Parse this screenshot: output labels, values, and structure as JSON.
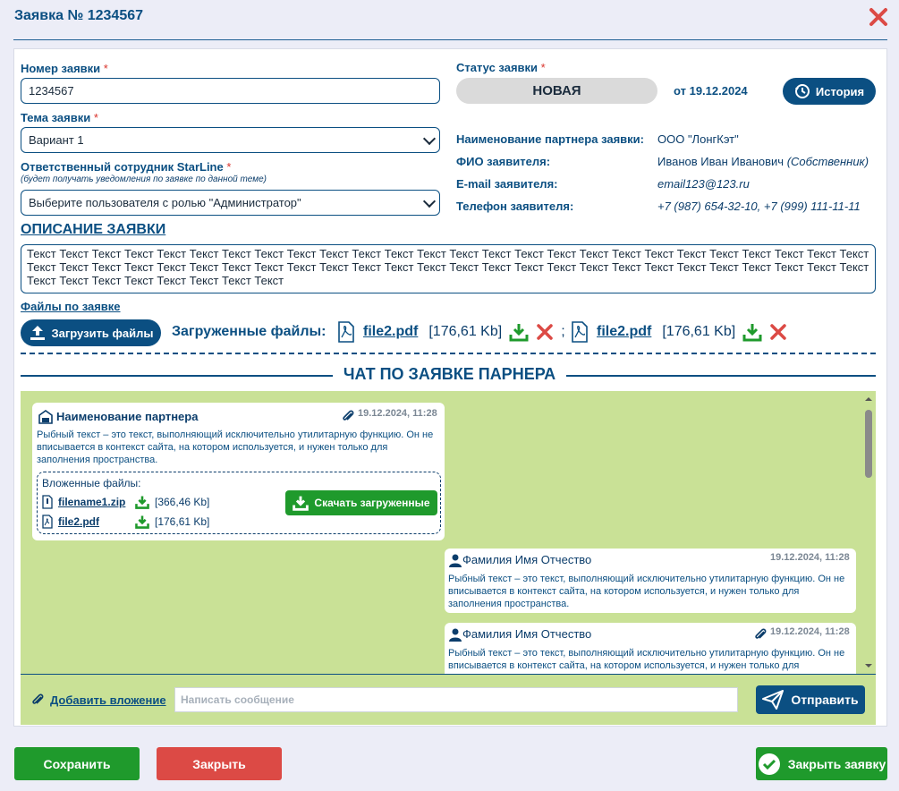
{
  "window": {
    "title": "Заявка № 1234567"
  },
  "form": {
    "number_label": "Номер заявки",
    "number_value": "1234567",
    "topic_label": "Тема заявки",
    "topic_value": "Вариант 1",
    "responsible_label": "Ответственный сотрудник StarLine",
    "responsible_hint": "(будет получать уведомления по заявке по данной теме)",
    "responsible_value": "Выберите пользователя с ролью \"Администратор\"",
    "required_mark": "*"
  },
  "status": {
    "label": "Статус заявки",
    "value": "НОВАЯ",
    "date": "от 19.12.2024",
    "history_label": "История"
  },
  "info": {
    "partner_label": "Наименование партнера заявки:",
    "partner_value": "ООО \"ЛонгКэт\"",
    "fio_label": "ФИО заявителя:",
    "fio_value": "Иванов Иван Иванович",
    "fio_role": "(Собственник)",
    "email_label": "E-mail заявителя:",
    "email_value": "email123@123.ru",
    "phone_label": "Телефон заявителя:",
    "phone_value": "+7 (987) 654-32-10, +7 (999) 111-11-11"
  },
  "description": {
    "title": "ОПИСАНИЕ ЗАЯВКИ",
    "text": "Текст Текст Текст Текст Текст Текст Текст Текст Текст Текст Текст Текст Текст Текст Текст Текст Текст Текст Текст Текст Текст Текст Текст Текст Текст Текст Текст Текст Текст Текст Текст Текст Текст Текст Текст Текст Текст Текст Текст Текст Текст Текст Текст Текст Текст Текст Текст Текст Текст Текст Текст Текст Текст Текст Текст Текст Текст Текст Текст Текст"
  },
  "files": {
    "label": "Файлы по заявке",
    "upload_label": "Загрузить файлы",
    "uploaded_label": "Загруженные файлы:",
    "separator": ";",
    "items": [
      {
        "name": "file2.pdf",
        "size": "[176,61 Kb]"
      },
      {
        "name": "file2.pdf",
        "size": "[176,61 Kb]"
      }
    ]
  },
  "chat": {
    "title": "ЧАТ ПО ЗАЯВКЕ ПАРНЕРА",
    "messages": [
      {
        "author": "Наименование партнера",
        "time": "19.12.2024, 11:28",
        "text": "Рыбный текст – это текст, выполняющий исключительно утилитарную функцию. Он не вписывается в контекст сайта, на котором используется, и нужен только для заполнения пространства.",
        "attachments_label": "Вложенные файлы:",
        "download_label": "Скачать загруженные",
        "attachments": [
          {
            "name": "filename1.zip",
            "size": "[366,46 Kb]"
          },
          {
            "name": "file2.pdf",
            "size": "[176,61 Kb]"
          }
        ]
      },
      {
        "author": "Фамилия Имя Отчество",
        "time": "19.12.2024, 11:28",
        "text": "Рыбный текст – это текст, выполняющий исключительно утилитарную функцию. Он не вписывается в контекст сайта, на котором используется, и нужен только для заполнения пространства."
      },
      {
        "author": "Фамилия Имя Отчество",
        "time": "19.12.2024, 11:28",
        "text": "Рыбный текст – это текст, выполняющий исключительно утилитарную функцию. Он не вписывается в контекст сайта, на котором используется, и нужен только для заполнения пространства."
      }
    ],
    "add_attachment_label": "Добавить вложение",
    "input_placeholder": "Написать сообщение",
    "send_label": "Отправить"
  },
  "footer": {
    "save_label": "Сохранить",
    "close_label": "Закрыть",
    "close_request_label": "Закрыть заявку"
  },
  "colors": {
    "primary": "#0b4f82",
    "success": "#1f9a2c",
    "danger": "#dc4a45",
    "chat_bg": "#c9e196"
  }
}
